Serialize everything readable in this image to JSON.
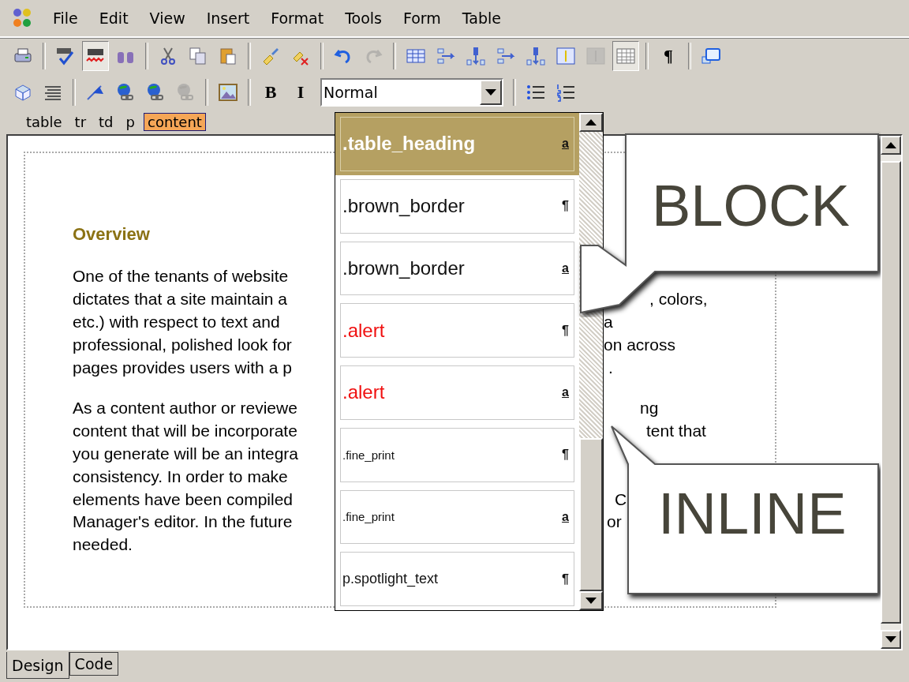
{
  "menu": [
    "File",
    "Edit",
    "View",
    "Insert",
    "Format",
    "Tools",
    "Form",
    "Table"
  ],
  "toolbar_1": [
    {
      "kind": "printer",
      "pressed": false,
      "disabled": false
    },
    {
      "kind": "sep"
    },
    {
      "kind": "spell",
      "pressed": false,
      "disabled": false
    },
    {
      "kind": "spell-live",
      "pressed": true,
      "disabled": false
    },
    {
      "kind": "binoculars",
      "pressed": false,
      "disabled": false
    },
    {
      "kind": "sep"
    },
    {
      "kind": "cut",
      "pressed": false,
      "disabled": false
    },
    {
      "kind": "copy",
      "pressed": false,
      "disabled": false
    },
    {
      "kind": "paste",
      "pressed": false,
      "disabled": false
    },
    {
      "kind": "sep"
    },
    {
      "kind": "brush",
      "pressed": false,
      "disabled": false
    },
    {
      "kind": "brush-clear",
      "pressed": false,
      "disabled": false
    },
    {
      "kind": "sep"
    },
    {
      "kind": "undo",
      "pressed": false,
      "disabled": false
    },
    {
      "kind": "redo",
      "pressed": false,
      "disabled": true
    },
    {
      "kind": "sep"
    },
    {
      "kind": "table",
      "pressed": false,
      "disabled": false
    },
    {
      "kind": "col",
      "pressed": false,
      "disabled": false
    },
    {
      "kind": "row",
      "pressed": false,
      "disabled": false
    },
    {
      "kind": "col",
      "pressed": false,
      "disabled": false
    },
    {
      "kind": "row",
      "pressed": false,
      "disabled": false
    },
    {
      "kind": "cell",
      "pressed": false,
      "disabled": false
    },
    {
      "kind": "cell",
      "pressed": false,
      "disabled": true
    },
    {
      "kind": "grid",
      "pressed": true,
      "disabled": false
    },
    {
      "kind": "sep"
    },
    {
      "kind": "text",
      "label": "¶",
      "pressed": false,
      "disabled": false
    },
    {
      "kind": "sep"
    },
    {
      "kind": "window",
      "pressed": false,
      "disabled": false
    }
  ],
  "toolbar_2": [
    {
      "kind": "box",
      "pressed": false,
      "disabled": false
    },
    {
      "kind": "align",
      "pressed": false,
      "disabled": false
    },
    {
      "kind": "sep"
    },
    {
      "kind": "flag",
      "pressed": false,
      "disabled": false
    },
    {
      "kind": "globe-link",
      "pressed": false,
      "disabled": false
    },
    {
      "kind": "globe-link",
      "pressed": false,
      "disabled": false
    },
    {
      "kind": "globe-link",
      "pressed": false,
      "disabled": true
    },
    {
      "kind": "sep"
    },
    {
      "kind": "image",
      "pressed": false,
      "disabled": false
    },
    {
      "kind": "sep"
    },
    {
      "kind": "text",
      "label": "B",
      "pressed": false,
      "disabled": false
    },
    {
      "kind": "text",
      "label": "I",
      "pressed": false,
      "disabled": false
    },
    {
      "kind": "style",
      "value": "Normal"
    },
    {
      "kind": "sep"
    },
    {
      "kind": "bullets",
      "pressed": false,
      "disabled": false
    },
    {
      "kind": "numbers",
      "pressed": false,
      "disabled": false
    }
  ],
  "tag_path": [
    {
      "label": "table",
      "selected": false
    },
    {
      "label": "tr",
      "selected": false
    },
    {
      "label": "td",
      "selected": false
    },
    {
      "label": "p",
      "selected": false
    },
    {
      "label": "content",
      "selected": true
    }
  ],
  "document": {
    "heading": "Overview",
    "paragraphs": [
      {
        "lines": [
          {
            "text": "One of the tenants of website"
          },
          {
            "text": "dictates that a site maintain a",
            "tail": ", colors,"
          },
          {
            "text": "etc.) with respect to text and",
            "tail": "a"
          },
          {
            "text": "professional, polished look for",
            "tail": "on across"
          },
          {
            "text": "pages provides users with a p",
            "tail": "."
          }
        ]
      },
      {
        "lines": [
          {
            "text": "As a content author or reviewe",
            "tail": "ng"
          },
          {
            "text": "content that will be incorporate",
            "tail": "tent that"
          },
          {
            "text": "you generate will be an integra"
          },
          {
            "text": "consistency.  In order to make"
          },
          {
            "text": "elements have been compiled",
            "tail": "C"
          },
          {
            "text": "Manager's editor.  In the future",
            "tail": "or"
          },
          {
            "text": "needed."
          }
        ]
      }
    ]
  },
  "style_list": [
    {
      "label": ".table_heading",
      "kind": "heading",
      "marker": "a",
      "selected": true
    },
    {
      "label": ".brown_border",
      "kind": "plain",
      "marker": "¶",
      "selected": false
    },
    {
      "label": ".brown_border",
      "kind": "plain",
      "marker": "a",
      "selected": false
    },
    {
      "label": ".alert",
      "kind": "alert",
      "marker": "¶",
      "selected": false
    },
    {
      "label": ".alert",
      "kind": "alert",
      "marker": "a",
      "selected": false
    },
    {
      "label": ".fine_print",
      "kind": "fine",
      "marker": "¶",
      "selected": false
    },
    {
      "label": ".fine_print",
      "kind": "fine",
      "marker": "a",
      "selected": false
    },
    {
      "label": "p.spotlight_text",
      "kind": "spotlight",
      "marker": "¶",
      "selected": false
    }
  ],
  "callouts": [
    {
      "label": "BLOCK"
    },
    {
      "label": "INLINE"
    }
  ],
  "view_tabs": [
    {
      "label": "Design",
      "selected": true
    },
    {
      "label": "Code",
      "selected": false
    }
  ]
}
